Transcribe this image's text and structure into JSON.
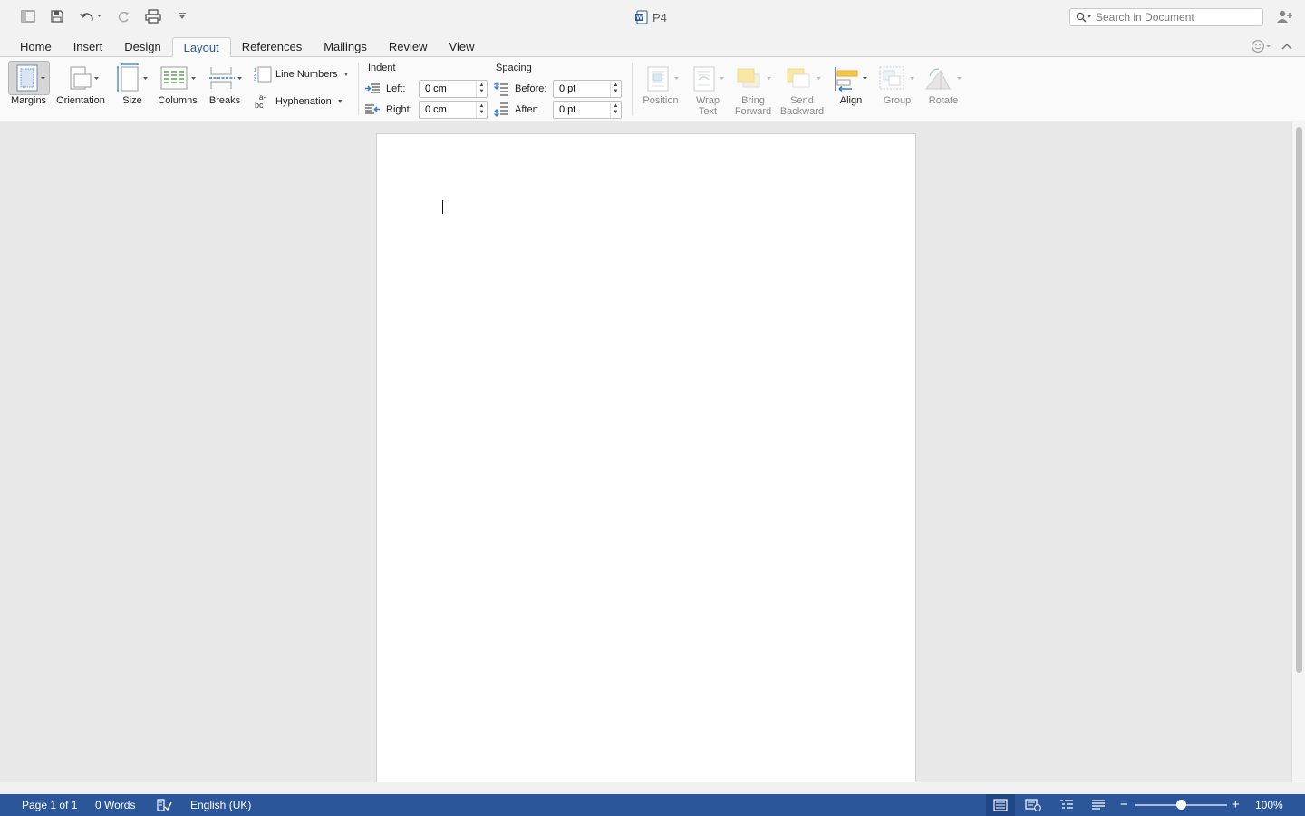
{
  "window": {
    "doc_title": "P4",
    "search_placeholder": "Search in Document"
  },
  "tabs": [
    {
      "label": "Home"
    },
    {
      "label": "Insert"
    },
    {
      "label": "Design"
    },
    {
      "label": "Layout",
      "active": true
    },
    {
      "label": "References"
    },
    {
      "label": "Mailings"
    },
    {
      "label": "Review"
    },
    {
      "label": "View"
    }
  ],
  "ribbon": {
    "margins": "Margins",
    "orientation": "Orientation",
    "size": "Size",
    "columns": "Columns",
    "breaks": "Breaks",
    "line_numbers": "Line Numbers",
    "hyphenation": "Hyphenation",
    "indent": {
      "title": "Indent",
      "left_label": "Left:",
      "left_value": "0 cm",
      "right_label": "Right:",
      "right_value": "0 cm"
    },
    "spacing": {
      "title": "Spacing",
      "before_label": "Before:",
      "before_value": "0 pt",
      "after_label": "After:",
      "after_value": "0 pt"
    },
    "position": "Position",
    "wrap_text_1": "Wrap",
    "wrap_text_2": "Text",
    "bring_forward_1": "Bring",
    "bring_forward_2": "Forward",
    "send_backward_1": "Send",
    "send_backward_2": "Backward",
    "align": "Align",
    "group": "Group",
    "rotate": "Rotate"
  },
  "status": {
    "page": "Page 1 of 1",
    "words": "0 Words",
    "language": "English (UK)",
    "zoom": "100%",
    "zoom_level": 1.0
  },
  "colors": {
    "accent": "#2b579a",
    "status_bar": "#2b579a"
  }
}
